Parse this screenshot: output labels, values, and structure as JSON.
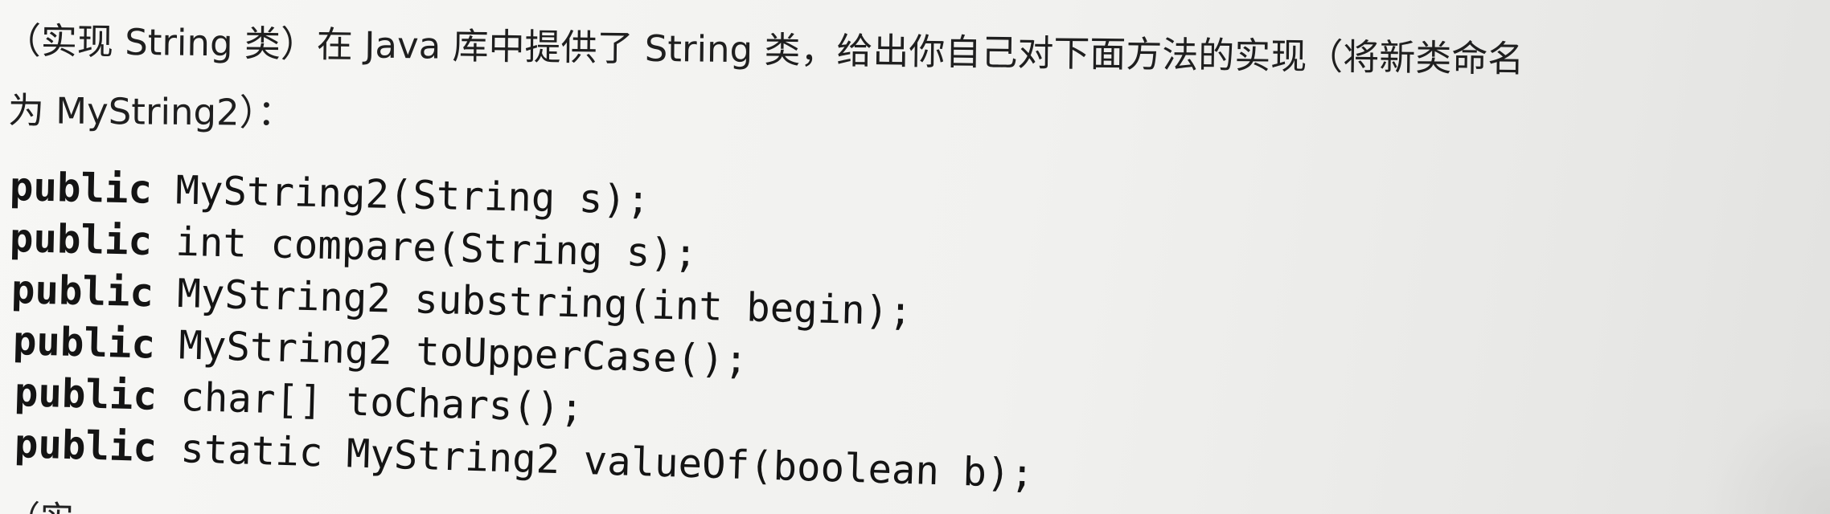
{
  "document": {
    "paragraph_line_1": "（实现 String 类）在 Java 库中提供了 String 类，给出你自己对下面方法的实现（将新类命名",
    "paragraph_line_2": "为 MyString2）：",
    "code_lines": [
      {
        "keyword": "public",
        "rest": " MyString2(String s);"
      },
      {
        "keyword": "public",
        "rest": " int compare(String s);"
      },
      {
        "keyword": "public",
        "rest": " MyString2 substring(int begin);"
      },
      {
        "keyword": "public",
        "rest": " MyString2 toUpperCase();"
      },
      {
        "keyword": "public",
        "rest": " char[] toChars();"
      },
      {
        "keyword": "public",
        "rest": " static MyString2 valueOf(boolean b);"
      }
    ],
    "cut_off_text": "（实现"
  }
}
